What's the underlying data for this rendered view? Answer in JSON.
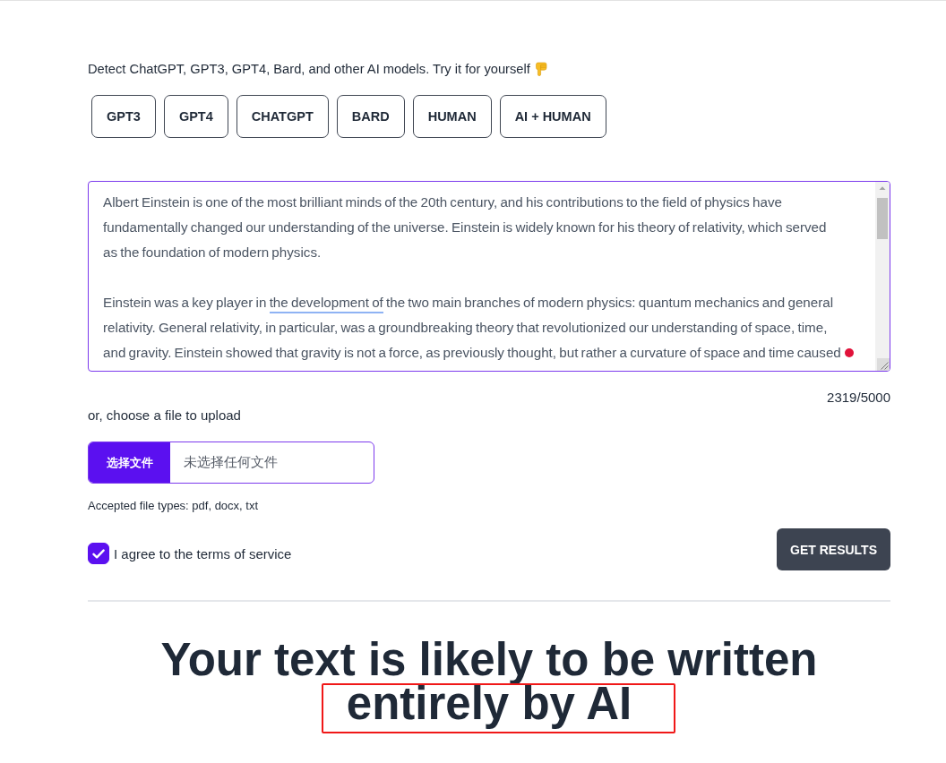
{
  "intro": {
    "text": "Detect ChatGPT, GPT3, GPT4, Bard, and other AI models. Try it for yourself"
  },
  "sample_buttons": [
    "GPT3",
    "GPT4",
    "CHATGPT",
    "BARD",
    "HUMAN",
    "AI + HUMAN"
  ],
  "text_input": {
    "paragraphs": [
      [
        {
          "text": "Albert Einstein is one of the most brilliant minds of the 20th century, and his contributions to the field of physics have fundamentally changed our understanding of the universe. Einstein is widely known for his theory of relativity, which served as the foundation of modern physics.",
          "underlined": false
        }
      ],
      [
        {
          "text": "Einstein was a key player in ",
          "underlined": false
        },
        {
          "text": "the development of",
          "underlined": true
        },
        {
          "text": " the two main branches of modern physics: quantum mechanics and general relativity. General relativity, in particular, was a groundbreaking theory that revolutionized our understanding of space, time, and gravity. Einstein showed that gravity is not a force, as previously thought, but rather a curvature of space and time caused",
          "underlined": false
        }
      ]
    ],
    "pointer_dot": true
  },
  "char_count": "2319/5000",
  "upload": {
    "label": "or, choose a file to upload",
    "button": "选择文件",
    "status": "未选择任何文件",
    "note": "Accepted file types: pdf, docx, txt"
  },
  "terms": {
    "label": "I agree to the terms of service",
    "checked": true
  },
  "submit_button": "GET RESULTS",
  "result": {
    "text": "Your text is likely to be written entirely by AI",
    "highlighted": true
  }
}
